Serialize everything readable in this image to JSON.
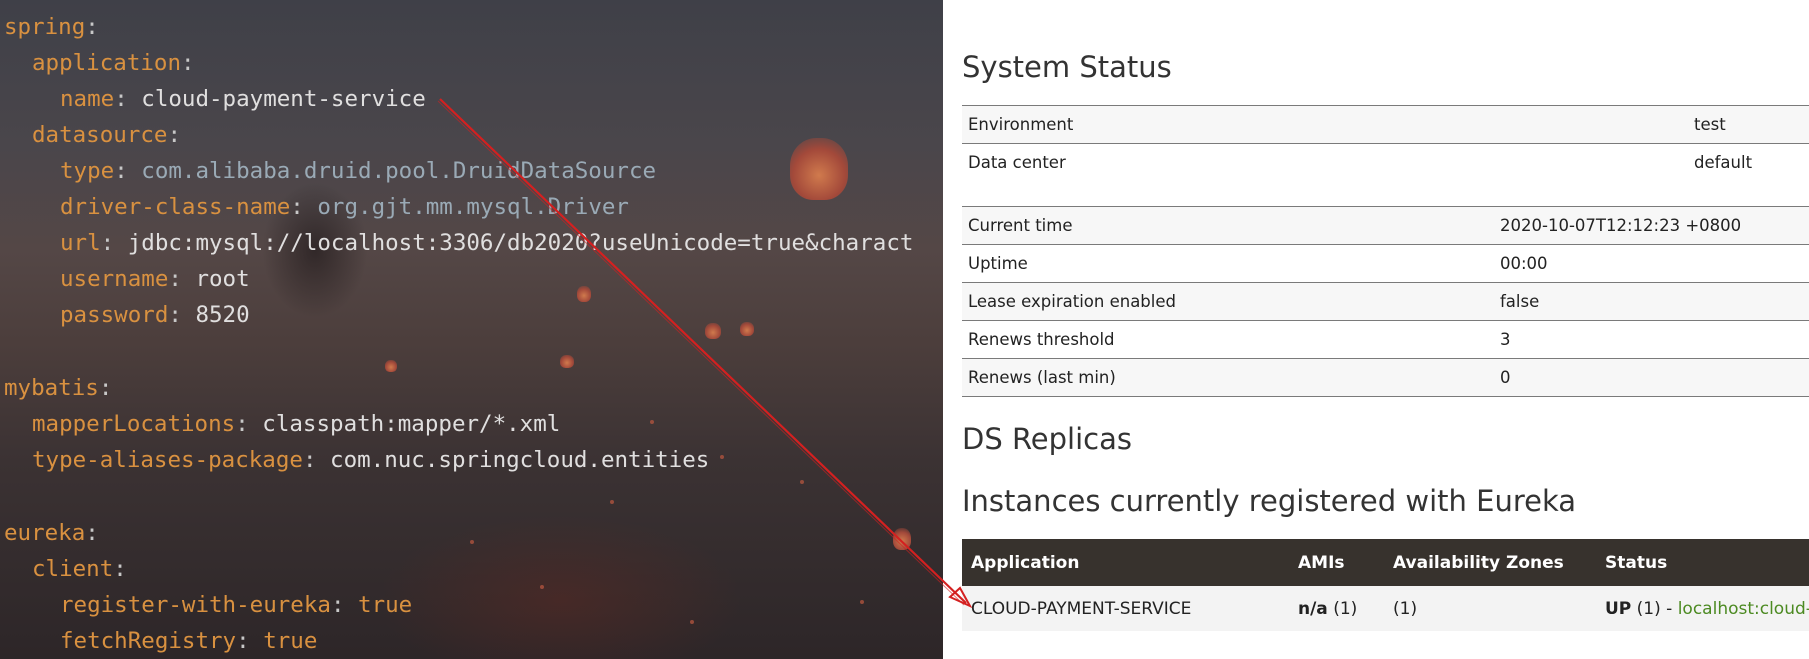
{
  "editor": {
    "lines": [
      {
        "key": "spring",
        "sep": ":",
        "value": "",
        "vstyle": "v"
      },
      {
        "key": "application",
        "sep": ":",
        "value": "",
        "vstyle": "v"
      },
      {
        "key": "name",
        "sep": ": ",
        "value": "cloud-payment-service",
        "vstyle": "v"
      },
      {
        "key": "datasource",
        "sep": ":",
        "value": "",
        "vstyle": "v"
      },
      {
        "key": "type",
        "sep": ": ",
        "value": "com.alibaba.druid.pool.DruidDataSource",
        "vstyle": "vc"
      },
      {
        "key": "driver-class-name",
        "sep": ": ",
        "value": "org.gjt.mm.mysql.Driver",
        "vstyle": "vc"
      },
      {
        "key": "url",
        "sep": ": ",
        "value": "jdbc:mysql://localhost:3306/db2020?useUnicode=true&charact",
        "vstyle": "v"
      },
      {
        "key": "username",
        "sep": ": ",
        "value": "root",
        "vstyle": "v"
      },
      {
        "key": "password",
        "sep": ": ",
        "value": "8520",
        "vstyle": "v"
      },
      {
        "key": "mybatis",
        "sep": ":",
        "value": "",
        "vstyle": "v"
      },
      {
        "key": "mapperLocations",
        "sep": ": ",
        "value": "classpath:mapper/*.xml",
        "vstyle": "v"
      },
      {
        "key": "type-aliases-package",
        "sep": ": ",
        "value": "com.nuc.springcloud.entities",
        "vstyle": "v"
      },
      {
        "key": "eureka",
        "sep": ":",
        "value": "",
        "vstyle": "v"
      },
      {
        "key": "client",
        "sep": ":",
        "value": "",
        "vstyle": "v"
      },
      {
        "key": "register-with-eureka",
        "sep": ": ",
        "value": "true",
        "vstyle": "k"
      },
      {
        "key": "fetchRegistry",
        "sep": ": ",
        "value": "true",
        "vstyle": "k"
      }
    ]
  },
  "eureka": {
    "system_status_title": "System Status",
    "status_rows_1": [
      {
        "label": "Environment",
        "value": "test"
      },
      {
        "label": "Data center",
        "value": "default"
      }
    ],
    "status_rows_2": [
      {
        "label": "Current time",
        "value": "2020-10-07T12:12:23 +0800"
      },
      {
        "label": "Uptime",
        "value": "00:00"
      },
      {
        "label": "Lease expiration enabled",
        "value": "false"
      },
      {
        "label": "Renews threshold",
        "value": "3"
      },
      {
        "label": "Renews (last min)",
        "value": "0"
      }
    ],
    "ds_replicas_title": "DS Replicas",
    "instances_title": "Instances currently registered with Eureka",
    "instances_headers": [
      "Application",
      "AMIs",
      "Availability Zones",
      "Status"
    ],
    "instances": [
      {
        "application": "CLOUD-PAYMENT-SERVICE",
        "amis_bold": "n/a",
        "amis_count": " (1)",
        "zones": "(1)",
        "status_bold": "UP",
        "status_rest": " (1) - ",
        "status_link": "localhost:cloud-"
      }
    ]
  },
  "colors": {
    "yaml_key": "#d99140",
    "yaml_value": "#e0dfdf",
    "arrow": "#d42020",
    "table_header_bg": "#37322d",
    "link_green": "#4c8a22"
  }
}
